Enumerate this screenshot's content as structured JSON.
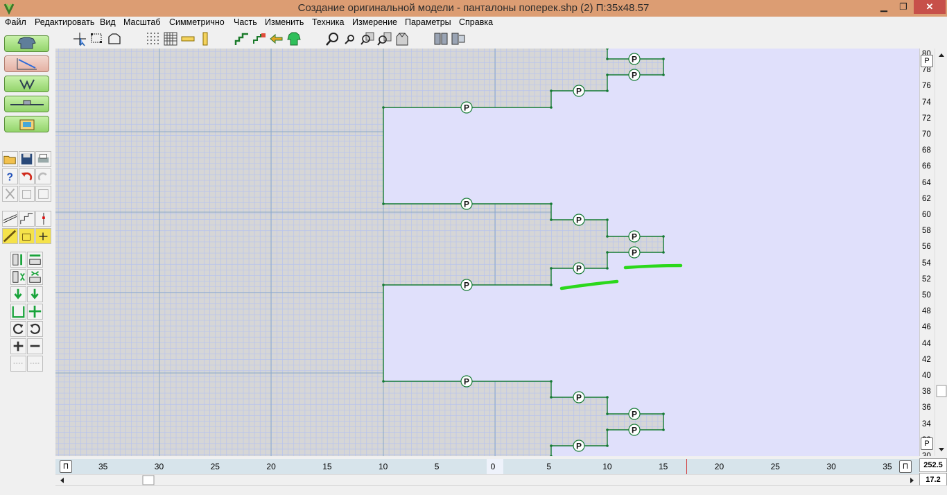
{
  "window": {
    "title": "Создание оригинальной модели - панталоны поперек.shp (2)     П:35x48.57",
    "minimize_glyph": "▁",
    "maximize_glyph": "❐",
    "close_glyph": "✕"
  },
  "menu": [
    "Файл",
    "Редактировать",
    "Вид",
    "Масштаб",
    "Симметрично",
    "Часть",
    "Изменить",
    "Техника",
    "Измерение",
    "Параметры",
    "Справка"
  ],
  "canvas": {
    "piece_marker_label": "P"
  },
  "vertical_ruler": {
    "labels": [
      "80",
      "78",
      "76",
      "74",
      "72",
      "70",
      "68",
      "66",
      "64",
      "62",
      "60",
      "58",
      "56",
      "54",
      "52",
      "50",
      "48",
      "46",
      "44",
      "42",
      "40",
      "38",
      "36",
      "34",
      "32",
      "30"
    ],
    "top_button": "P",
    "bottom_button": "P"
  },
  "horizontal_ruler": {
    "labels": [
      "35",
      "30",
      "25",
      "20",
      "15",
      "10",
      "5",
      "0",
      "5",
      "10",
      "15",
      "20",
      "25",
      "30",
      "35"
    ],
    "left_button": "П",
    "right_button": "П"
  },
  "counters": {
    "top": "252.5",
    "bottom": "17.2"
  },
  "icons": {
    "left_panel": [
      "garment-icon",
      "knit-pattern-icon",
      "symmetry-icon",
      "measure-icon",
      "folder-card-icon",
      "open-icon",
      "save-icon",
      "print-icon",
      "help-icon",
      "undo-icon",
      "redo-icon",
      "cut-icon",
      "copy-icon",
      "paste-icon"
    ],
    "toolbar": [
      "select-arrow-icon",
      "select-points-icon",
      "select-shape-icon",
      "dot-grid-icon",
      "grid-icon",
      "h-ruler-icon",
      "v-ruler-icon",
      "step-shape-icon",
      "step-small-icon",
      "arrow-left-icon",
      "sweater-icon",
      "zoom-in-icon",
      "zoom-out-icon",
      "zoom-fit-icon",
      "zoom-region-icon",
      "zoom-selection-icon",
      "view-pieces-icon",
      "view-layout-icon"
    ]
  },
  "colors": {
    "title_bar": "#dc9d73",
    "canvas_bg": "#e0e0fb",
    "piece_fill": "#d6d6d6",
    "grid_minor": "#b7c3ee",
    "grid_major": "#8aa8c8",
    "outline": "#147a33",
    "highlight": "#2bd81b"
  }
}
